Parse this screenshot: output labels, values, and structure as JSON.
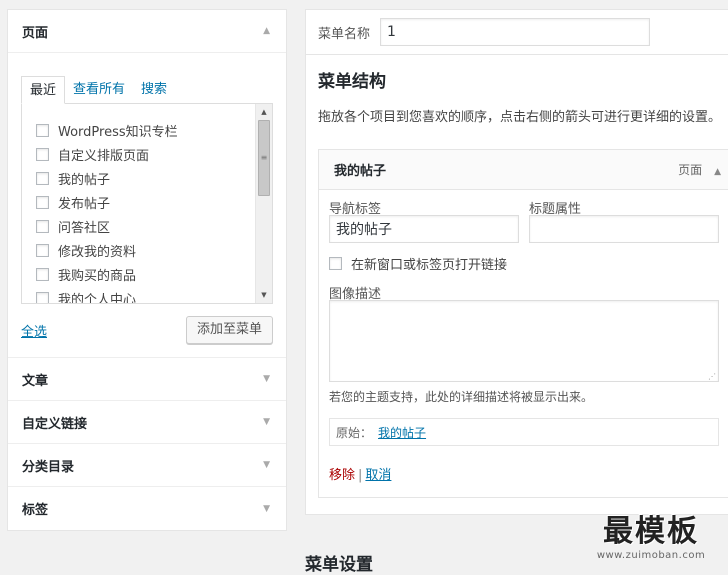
{
  "left": {
    "pages": {
      "title": "页面",
      "tabs": [
        "最近",
        "查看所有",
        "搜索"
      ],
      "items": [
        "WordPress知识专栏",
        "自定义排版页面",
        "我的帖子",
        "发布帖子",
        "问答社区",
        "修改我的资料",
        "我购买的商品",
        "我的个人中心"
      ],
      "select_all": "全选",
      "add_button": "添加至菜单"
    },
    "collapsed": [
      "文章",
      "自定义链接",
      "分类目录",
      "标签"
    ]
  },
  "right": {
    "menu_name_label": "菜单名称",
    "menu_name_value": "1",
    "structure_title": "菜单结构",
    "structure_desc": "拖放各个项目到您喜欢的顺序，点击右侧的箭头可进行更详细的设置。",
    "item": {
      "title": "我的帖子",
      "type": "页面",
      "nav_label_label": "导航标签",
      "nav_label_value": "我的帖子",
      "title_attr_label": "标题属性",
      "title_attr_value": "",
      "new_tab_label": "在新窗口或标签页打开链接",
      "image_desc_label": "图像描述",
      "hint": "若您的主题支持，此处的详细描述将被显示出来。",
      "original_label": "原始：",
      "original_link": "我的帖子",
      "remove": "移除",
      "separator": "|",
      "cancel": "取消"
    },
    "settings_title": "菜单设置"
  },
  "watermark": {
    "main": "最模板",
    "url": "www.zuimoban.com"
  }
}
